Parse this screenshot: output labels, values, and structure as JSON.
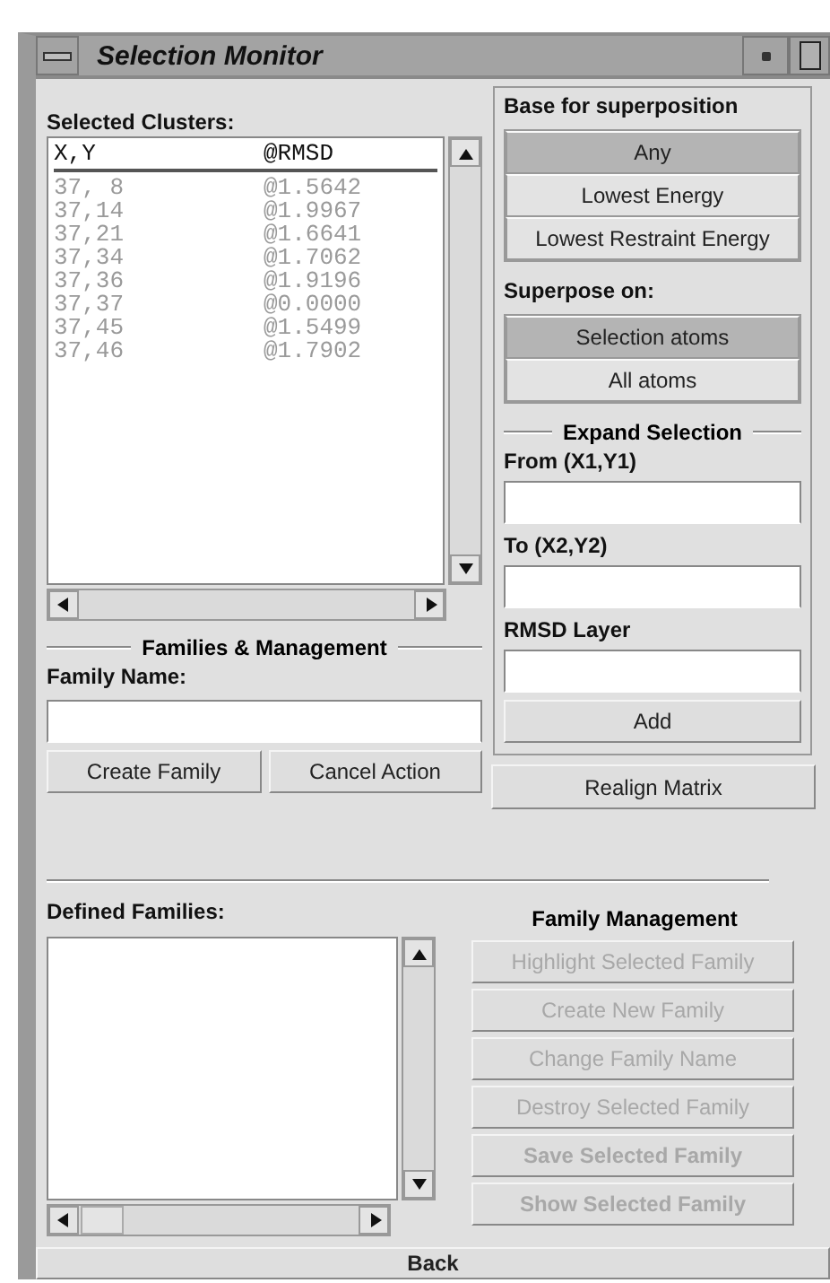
{
  "window": {
    "title": "Selection Monitor"
  },
  "selected_clusters": {
    "label": "Selected Clusters:",
    "columns": [
      "X,Y",
      "@RMSD"
    ],
    "dimmed": true,
    "rows": [
      [
        "37, 8",
        "@1.5642"
      ],
      [
        "37,14",
        "@1.9967"
      ],
      [
        "37,21",
        "@1.6641"
      ],
      [
        "37,34",
        "@1.7062"
      ],
      [
        "37,36",
        "@1.9196"
      ],
      [
        "37,37",
        "@0.0000"
      ],
      [
        "37,45",
        "@1.5499"
      ],
      [
        "37,46",
        "@1.7902"
      ]
    ]
  },
  "base_for_superposition": {
    "label": "Base for superposition",
    "options": [
      {
        "label": "Any",
        "selected": true
      },
      {
        "label": "Lowest Energy",
        "selected": false
      },
      {
        "label": "Lowest Restraint Energy",
        "selected": false
      }
    ]
  },
  "superpose_on": {
    "label": "Superpose on:",
    "options": [
      {
        "label": "Selection atoms",
        "selected": true
      },
      {
        "label": "All atoms",
        "selected": false
      }
    ]
  },
  "expand_selection": {
    "heading": "Expand Selection",
    "fields": [
      {
        "label": "From (X1,Y1)"
      },
      {
        "label": "To (X2,Y2)"
      },
      {
        "label": "RMSD Layer"
      }
    ],
    "button": "Add"
  },
  "realign_button": "Realign Matrix",
  "families": {
    "heading": "Families & Management",
    "field_label": "Family Name:",
    "buttons": [
      "Create Family",
      "Cancel Action"
    ]
  },
  "defined_families": {
    "label": "Defined Families:"
  },
  "family_management": {
    "heading": "Family Management",
    "buttons": [
      {
        "label": "Highlight Selected Family",
        "disabled": true,
        "bold": false
      },
      {
        "label": "Create New Family",
        "disabled": true,
        "bold": false
      },
      {
        "label": "Change Family Name",
        "disabled": true,
        "bold": false
      },
      {
        "label": "Destroy Selected Family",
        "disabled": true,
        "bold": false
      },
      {
        "label": "Save Selected Family",
        "disabled": true,
        "bold": true
      },
      {
        "label": "Show Selected Family",
        "disabled": true,
        "bold": true
      }
    ]
  },
  "back_button": "Back"
}
